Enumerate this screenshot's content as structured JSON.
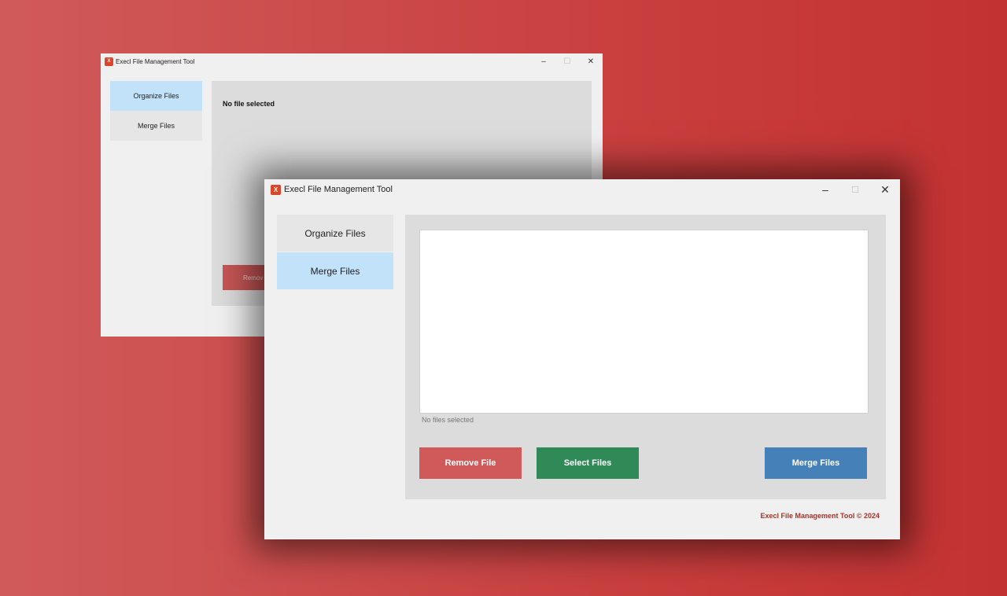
{
  "back_window": {
    "title": "Execl File Management Tool",
    "icon_text": "X",
    "nav": [
      {
        "label": "Organize Files",
        "active": true
      },
      {
        "label": "Merge Files",
        "active": false
      }
    ],
    "status": "No file selected",
    "remove_button_partial": "Remov"
  },
  "front_window": {
    "title": "Execl File Management Tool",
    "icon_text": "X",
    "nav": [
      {
        "label": "Organize Files",
        "active": false
      },
      {
        "label": "Merge Files",
        "active": true
      }
    ],
    "status": "No files selected",
    "buttons": {
      "remove": "Remove File",
      "select": "Select Files",
      "merge": "Merge Files"
    },
    "footer": "Execl File Management Tool © 2024"
  },
  "window_controls": {
    "minimize": "–",
    "maximize": "☐",
    "close": "✕"
  },
  "colors": {
    "background_start": "#d05a5a",
    "background_end": "#c33232",
    "nav_active": "#c2e2fa",
    "nav_inactive": "#e6e6e6",
    "remove_button": "#d05a5a",
    "select_button": "#2f8a57",
    "merge_button": "#4580b8",
    "footer_text": "#a8322a",
    "app_icon": "#d9462c"
  }
}
